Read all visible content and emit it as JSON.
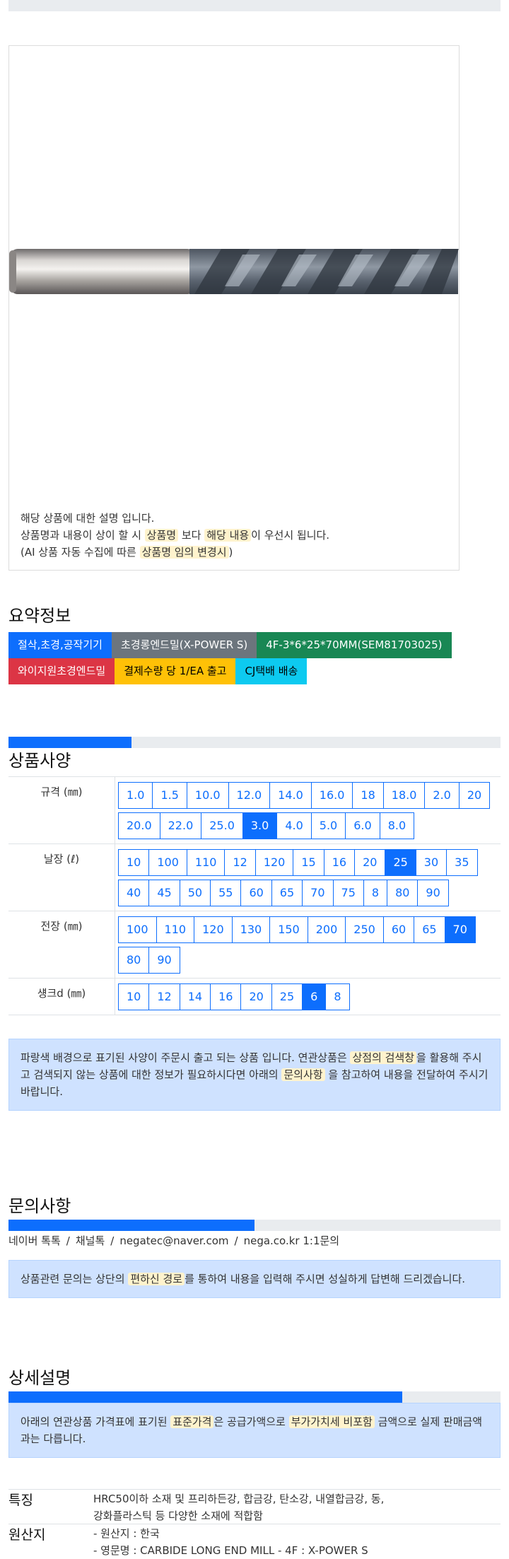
{
  "product_image": {
    "description_lines": [
      {
        "parts": [
          {
            "t": "해당 상품에 대한 설명 입니다.",
            "h": false
          }
        ]
      },
      {
        "parts": [
          {
            "t": "상품명과 내용이 상이 할 시 ",
            "h": false
          },
          {
            "t": "상품명",
            "h": true
          },
          {
            "t": " 보다 ",
            "h": false
          },
          {
            "t": "해당 내용",
            "h": true
          },
          {
            "t": "이 우선시 됩니다.",
            "h": false
          }
        ]
      },
      {
        "parts": [
          {
            "t": "(AI 상품 자동 수집에 따른 ",
            "h": false
          },
          {
            "t": "상품명 임의 변경시",
            "h": true
          },
          {
            "t": ")",
            "h": false
          }
        ]
      }
    ]
  },
  "summary": {
    "title": "요약정보",
    "badges": [
      [
        {
          "text": "절삭,초경,공작기기",
          "bg": "#0d6efd",
          "fg": "#ffffff"
        },
        {
          "text": "초경롱엔드밀(X-POWER S)",
          "bg": "#6c757d",
          "fg": "#ffffff"
        },
        {
          "text": "4F-3*6*25*70MM(SEM81703025)",
          "bg": "#198754",
          "fg": "#ffffff"
        }
      ],
      [
        {
          "text": "와이지원초경엔드밀",
          "bg": "#dc3545",
          "fg": "#ffffff"
        },
        {
          "text": "결제수량 당 1/EA 출고",
          "bg": "#ffc107",
          "fg": "#000000"
        },
        {
          "text": "CJ택배 배송",
          "bg": "#0dcaf0",
          "fg": "#000000"
        }
      ]
    ]
  },
  "spec": {
    "title": "상품사양",
    "progress": 0.25,
    "rows": [
      {
        "label": "규격 (㎜)",
        "selected": "3.0",
        "options": [
          "1.0",
          "1.5",
          "10.0",
          "12.0",
          "14.0",
          "16.0",
          "18",
          "18.0",
          "2.0",
          "20",
          "20.0",
          "22.0",
          "25.0",
          "3.0",
          "4.0",
          "5.0",
          "6.0",
          "8.0"
        ]
      },
      {
        "label": "날장 (ℓ)",
        "selected": "25",
        "options": [
          "10",
          "100",
          "110",
          "12",
          "120",
          "15",
          "16",
          "20",
          "25",
          "30",
          "35",
          "40",
          "45",
          "50",
          "55",
          "60",
          "65",
          "70",
          "75",
          "8",
          "80",
          "90"
        ]
      },
      {
        "label": "전장 (㎜)",
        "selected": "70",
        "options": [
          "100",
          "110",
          "120",
          "130",
          "150",
          "200",
          "250",
          "60",
          "65",
          "70",
          "80",
          "90"
        ]
      },
      {
        "label": "섕크d (㎜)",
        "selected": "6",
        "options": [
          "10",
          "12",
          "14",
          "16",
          "20",
          "25",
          "6",
          "8"
        ]
      }
    ],
    "notice_parts": [
      {
        "t": "파랑색 배경으로 표기된 사양이 주문시 출고 되는 상품 입니다. 연관상품은 ",
        "h": false
      },
      {
        "t": "상점의 검색창",
        "h": true
      },
      {
        "t": "을 활용해 주시고 검색되지 않는 상품에 대한 정보가 필요하시다면 아래의 ",
        "h": false
      },
      {
        "t": "문의사항",
        "h": true
      },
      {
        "t": " 을 참고하여 내용을 전달하여 주시기 바랍니다.",
        "h": false
      }
    ]
  },
  "inquiry": {
    "title": "문의사항",
    "progress": 0.5,
    "contacts": [
      "네이버 톡톡",
      "채널톡",
      "negatec@naver.com",
      "nega.co.kr 1:1문의"
    ],
    "separator": "/",
    "notice_parts": [
      {
        "t": "상품관련 문의는 상단의 ",
        "h": false
      },
      {
        "t": "편하신 경로",
        "h": true
      },
      {
        "t": "를 통하여 내용을 입력해 주시면 성실하게 답변해 드리겠습니다.",
        "h": false
      }
    ]
  },
  "detail": {
    "title": "상세설명",
    "progress": 0.8,
    "notice_parts": [
      {
        "t": "아래의 연관상품 가격표에 표기된 ",
        "h": false
      },
      {
        "t": "표준가격",
        "h": true
      },
      {
        "t": "은 공급가액으로 ",
        "h": false
      },
      {
        "t": "부가가치세 비포함",
        "h": true
      },
      {
        "t": " 금액으로 실제 판매금액과는 다릅니다.",
        "h": false
      }
    ],
    "features_label": "특징",
    "features_lines": [
      "HRC50이하 소재 및 프리하든강, 합금강, 탄소강, 내열합금강, 동,",
      "강화플라스틱 등 다양한 소재에 적합함"
    ],
    "origin_label": "원산지",
    "origin_lines": [
      "- 원산지 : 한국",
      "- 영문명 : CARBIDE LONG END MILL - 4F : X-POWER S"
    ]
  }
}
